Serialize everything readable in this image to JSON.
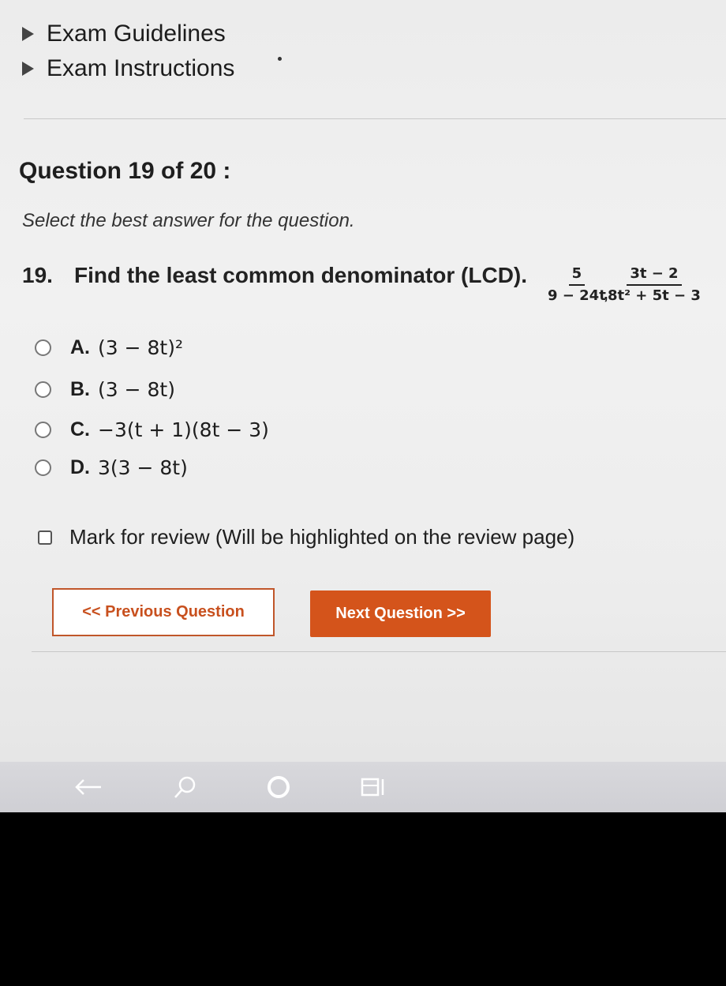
{
  "nav": {
    "items": [
      {
        "label": "Exam Guidelines"
      },
      {
        "label": "Exam Instructions"
      }
    ]
  },
  "question": {
    "header": "Question 19 of 20 :",
    "instruction": "Select the best answer for the question.",
    "number": "19.",
    "text": "Find the least common denominator (LCD).",
    "fractions": [
      {
        "numerator": "5",
        "denominator": "9 − 24t"
      },
      {
        "numerator": "3t − 2",
        "denominator": "8t² + 5t − 3"
      }
    ],
    "separator": ","
  },
  "options": [
    {
      "letter": "A.",
      "expr": "(3 − 8t)²"
    },
    {
      "letter": "B.",
      "expr": "(3 − 8t)"
    },
    {
      "letter": "C.",
      "expr": "−3(t + 1)(8t − 3)"
    },
    {
      "letter": "D.",
      "expr": "3(3 − 8t)"
    }
  ],
  "review": {
    "label": "Mark for review (Will be highlighted on the review page)"
  },
  "buttons": {
    "prev_label": "<< Previous Question",
    "next_label": "Next Question >>"
  },
  "taskbar": {
    "icons": [
      "back-arrow-icon",
      "search-icon",
      "home-circle-icon",
      "recent-apps-icon"
    ]
  },
  "colors": {
    "accent": "#d4541b",
    "background": "#efefef"
  }
}
